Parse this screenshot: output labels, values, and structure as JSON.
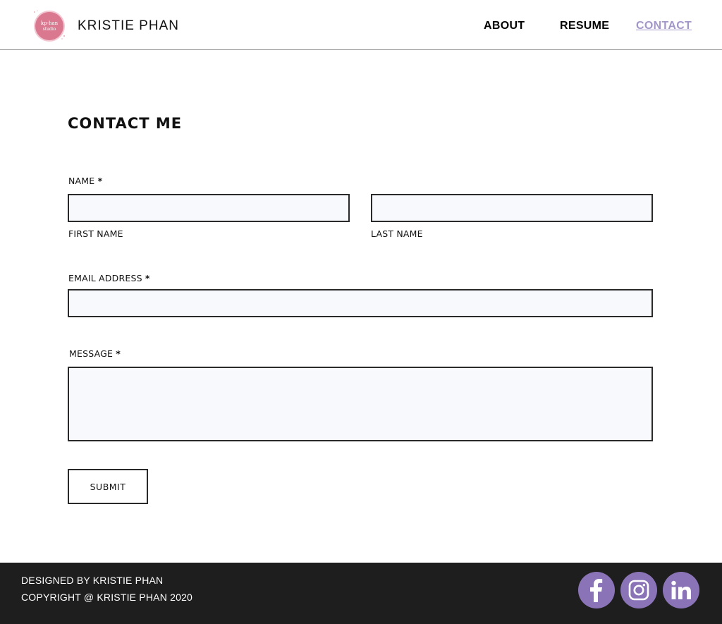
{
  "header": {
    "brand": "KRISTIE PHAN",
    "logo_text_1": "kp-han",
    "logo_text_2": "studio",
    "logo_color": "#d9788f",
    "nav": [
      {
        "label": "ABOUT",
        "active": false
      },
      {
        "label": "RESUME",
        "active": false
      },
      {
        "label": "CONTACT",
        "active": true
      }
    ],
    "active_color": "#a397c9"
  },
  "form": {
    "title": "CONTACT ME",
    "name_label": "NAME",
    "required_mark": "*",
    "first_name_label": "FIRST NAME",
    "last_name_label": "LAST NAME",
    "email_label": "EMAIL ADDRESS",
    "message_label": "MESSAGE",
    "first_name_value": "",
    "last_name_value": "",
    "email_value": "",
    "message_value": "",
    "submit_label": "SUBMIT"
  },
  "footer": {
    "designed_by": "DESIGNED BY KRISTIE PHAN",
    "copyright": "COPYRIGHT @ KRISTIE PHAN 2020",
    "social": [
      "facebook-icon",
      "instagram-icon",
      "linkedin-icon"
    ],
    "social_color": "#8a74b7"
  }
}
